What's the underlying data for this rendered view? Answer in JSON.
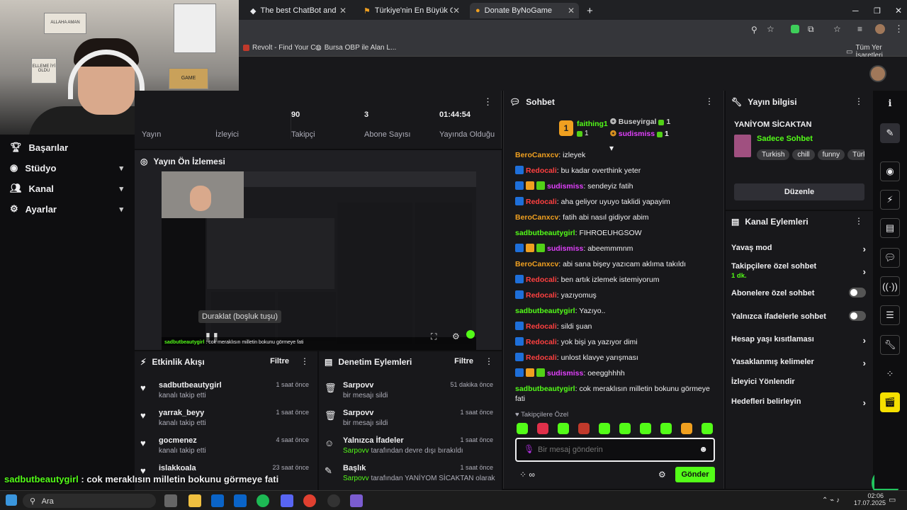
{
  "browser": {
    "tabs": [
      {
        "title": "The best ChatBot and Widgets"
      },
      {
        "title": "Türkiye'nin En Büyük Oyuncu D"
      },
      {
        "title": "Donate ByNoGame"
      }
    ],
    "new_tab": "+",
    "bookmarks": [
      {
        "title": "Revolt - Find Your C..."
      },
      {
        "title": "Bursa OBP ile Alan L..."
      }
    ],
    "all_bookmarks": "Tüm Yer İşaretleri"
  },
  "webcam": {
    "posters": [
      "ALLAHA AMAN",
      "ELLEME İYİ OLDU",
      "GAME"
    ]
  },
  "nav": {
    "items": [
      {
        "label": "Başarılar",
        "icon": "trophy-icon"
      },
      {
        "label": "Stüdyo",
        "icon": "camera-icon"
      },
      {
        "label": "Kanal",
        "icon": "users-icon"
      },
      {
        "label": "Ayarlar",
        "icon": "gear-icon"
      }
    ]
  },
  "stats": {
    "items": [
      {
        "value": "",
        "label": "Yayın"
      },
      {
        "value": "",
        "label": "İzleyici"
      },
      {
        "value": "90",
        "label": "Takipçi"
      },
      {
        "value": "3",
        "label": "Abone Sayısı"
      },
      {
        "value": "01:44:54",
        "label": "Yayında Olduğu"
      }
    ]
  },
  "preview": {
    "title": "Yayın Ön İzlemesi",
    "pause_tooltip": "Duraklat (boşluk tuşu)",
    "caption_user": "sadbutbeautygirl",
    "caption_text": "cok meraklısın milletin bokunu görmeye fati"
  },
  "activity": {
    "title": "Etkinlik Akışı",
    "filter": "Filtre",
    "items": [
      {
        "name": "sadbutbeautygirl",
        "sub": "kanalı takip etti",
        "time": "1 saat önce"
      },
      {
        "name": "yarrak_beyy",
        "sub": "kanalı takip etti",
        "time": "1 saat önce"
      },
      {
        "name": "gocmenez",
        "sub": "kanalı takip etti",
        "time": "4 saat önce"
      },
      {
        "name": "islakkoala",
        "sub": "",
        "time": "23 saat önce"
      }
    ]
  },
  "moderation": {
    "title": "Denetim Eylemleri",
    "filter": "Filtre",
    "items": [
      {
        "name": "Sarpovv",
        "sub_user": "",
        "sub": "bir mesajı sildi",
        "time": "51 dakika önce",
        "icon": "trash-icon"
      },
      {
        "name": "Sarpovv",
        "sub_user": "",
        "sub": "bir mesajı sildi",
        "time": "1 saat önce",
        "icon": "trash-icon"
      },
      {
        "name": "Yalnızca İfadeler",
        "sub_user": "Sarpovv",
        "sub": "tarafından devre dışı bırakıldı",
        "time": "1 saat önce",
        "icon": "smile-icon"
      },
      {
        "name": "Başlık",
        "sub_user": "Sarpovv",
        "sub": "tarafından YANİYOM SİCAKTAN olarak",
        "time": "1 saat önce",
        "icon": "edit-icon"
      }
    ]
  },
  "chat": {
    "title": "Sohbet",
    "top": [
      {
        "rank": "1",
        "name": "faithing1",
        "count": "1"
      },
      {
        "rank": "",
        "name": "Buseyirgal",
        "count": "1"
      },
      {
        "rank": "",
        "name": "sudismiss",
        "count": "1"
      }
    ],
    "messages": [
      {
        "user": "BeroCanxcv",
        "text": "izleyek",
        "color": "#f0a020",
        "badges": []
      },
      {
        "user": "Redocali",
        "text": "bu kadar overthink yeter",
        "color": "#ff4040",
        "badges": [
          "b1"
        ]
      },
      {
        "user": "sudismiss",
        "text": "sendeyiz fatih",
        "color": "#e040fb",
        "badges": [
          "b1",
          "b2",
          "b3"
        ]
      },
      {
        "user": "Redocali",
        "text": "aha geliyor uyuyo taklidi yapayim",
        "color": "#ff4040",
        "badges": [
          "b1"
        ]
      },
      {
        "user": "BeroCanxcv",
        "text": "fatih abi nasıl gidiyor abim",
        "color": "#f0a020",
        "badges": []
      },
      {
        "user": "sadbutbeautygirl",
        "text": "FIHROEUHGSOW",
        "color": "#53fc18",
        "badges": []
      },
      {
        "user": "sudismiss",
        "text": "abeemmmnm",
        "color": "#e040fb",
        "badges": [
          "b1",
          "b2",
          "b3"
        ]
      },
      {
        "user": "BeroCanxcv",
        "text": "abi sana bişey yazıcam aklıma takıldı",
        "color": "#f0a020",
        "badges": []
      },
      {
        "user": "Redocali",
        "text": "ben artık izlemek istemiyorum",
        "color": "#ff4040",
        "badges": [
          "b1"
        ]
      },
      {
        "user": "Redocali",
        "text": "yazıyomuş",
        "color": "#ff4040",
        "badges": [
          "b1"
        ]
      },
      {
        "user": "sadbutbeautygirl",
        "text": "Yazıyo..",
        "color": "#53fc18",
        "badges": []
      },
      {
        "user": "Redocali",
        "text": "sildi şuan",
        "color": "#ff4040",
        "badges": [
          "b1"
        ]
      },
      {
        "user": "Redocali",
        "text": "yok bişi ya yazıyor dimi",
        "color": "#ff4040",
        "badges": [
          "b1"
        ]
      },
      {
        "user": "Redocali",
        "text": "unlost klavye yarışması",
        "color": "#ff4040",
        "badges": [
          "b1"
        ]
      },
      {
        "user": "sudismiss",
        "text": "oeegghhhh",
        "color": "#e040fb",
        "badges": [
          "b1",
          "b2",
          "b3"
        ]
      },
      {
        "user": "sadbutbeautygirl",
        "text": "cok meraklısın milletin bokunu görmeye fati",
        "color": "#53fc18",
        "badges": []
      }
    ],
    "followers_only": "Takipçilere Özel",
    "input_placeholder": "Bir mesaj gönderin",
    "send": "Gönder",
    "emote_colors": [
      "#53fc18",
      "#e0304a",
      "#53fc18",
      "#c0392b",
      "#53fc18",
      "#53fc18",
      "#53fc18",
      "#53fc18",
      "#f0a020",
      "#53fc18"
    ]
  },
  "stream_info": {
    "title_label": "Yayın bilgisi",
    "stream_title": "YANİYOM SİCAKTAN",
    "category": "Sadece Sohbet",
    "tags": [
      "Turkish",
      "chill",
      "funny",
      "Türkç"
    ],
    "edit": "Düzenle"
  },
  "channel_actions": {
    "title": "Kanal Eylemleri",
    "items": [
      {
        "label": "Yavaş mod",
        "sub": "",
        "control": "chevron"
      },
      {
        "label": "Takipçilere özel sohbet",
        "sub": "1 dk.",
        "control": "chevron"
      },
      {
        "label": "Abonelere özel sohbet",
        "sub": "",
        "control": "toggle"
      },
      {
        "label": "Yalnızca ifadelerle sohbet",
        "sub": "",
        "control": "toggle"
      },
      {
        "label": "Hesap yaşı kısıtlaması",
        "sub": "",
        "control": "chevron"
      },
      {
        "label": "Yasaklanmış kelimeler",
        "sub": "",
        "control": "chevron"
      },
      {
        "label": "İzleyici Yönlendir",
        "sub": "",
        "control": "none"
      },
      {
        "label": "Hedefleri belirleyin",
        "sub": "",
        "control": "chevron"
      }
    ]
  },
  "overlay": {
    "user": "sadbutbeautygirl",
    "text": ": cok meraklısın milletin bokunu görmeye fati"
  },
  "taskbar": {
    "search": "Ara",
    "time": "02:06",
    "date": "17.07.2025"
  },
  "colors": {
    "accent": "#53fc18",
    "bg": "#0e0e10",
    "panel": "#18181b"
  }
}
